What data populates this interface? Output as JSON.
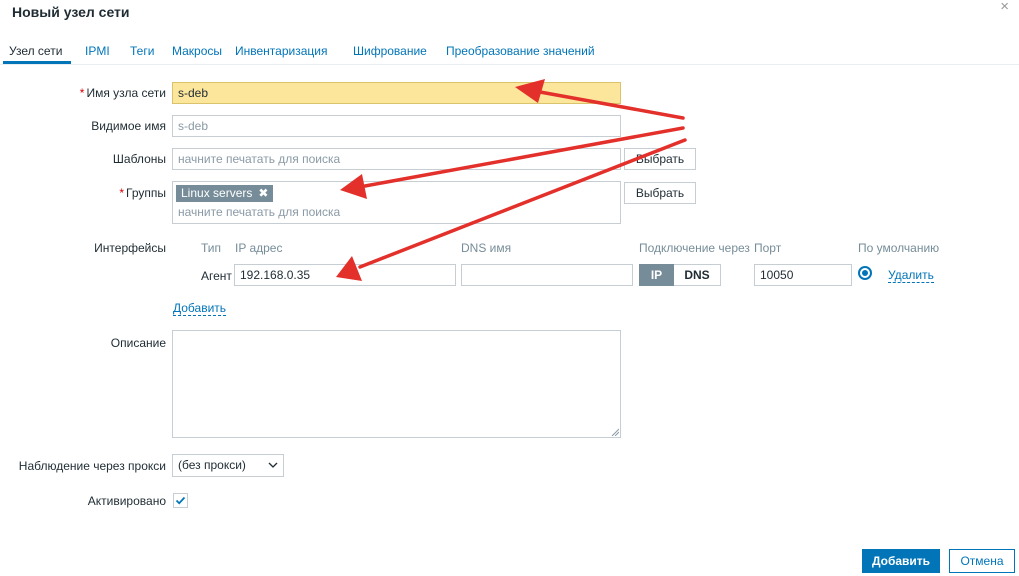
{
  "dialog": {
    "title": "Новый узел сети",
    "close_glyph": "×"
  },
  "tabs": [
    {
      "label": "Узел сети"
    },
    {
      "label": "IPMI"
    },
    {
      "label": "Теги"
    },
    {
      "label": "Макросы"
    },
    {
      "label": "Инвентаризация"
    },
    {
      "label": "Шифрование"
    },
    {
      "label": "Преобразование значений"
    }
  ],
  "required_mark": "*",
  "form": {
    "host_name": {
      "label": "Имя узла сети",
      "value": "s-deb"
    },
    "visible_name": {
      "label": "Видимое имя",
      "placeholder": "s-deb"
    },
    "templates": {
      "label": "Шаблоны",
      "placeholder": "начните печатать для поиска",
      "button": "Выбрать"
    },
    "groups": {
      "label": "Группы",
      "chip": "Linux servers",
      "chip_remove": "✖",
      "placeholder": "начните печатать для поиска",
      "button": "Выбрать"
    },
    "interfaces": {
      "label": "Интерфейсы",
      "headers": {
        "type": "Тип",
        "ip": "IP адрес",
        "dns": "DNS имя",
        "connect": "Подключение через",
        "port": "Порт",
        "default": "По умолчанию"
      },
      "row": {
        "type": "Агент",
        "ip": "192.168.0.35",
        "dns": "",
        "connect_ip": "IP",
        "connect_dns": "DNS",
        "port": "10050",
        "remove": "Удалить"
      },
      "add": "Добавить"
    },
    "description": {
      "label": "Описание",
      "value": ""
    },
    "proxy": {
      "label": "Наблюдение через прокси",
      "value": "(без прокси)"
    },
    "enabled": {
      "label": "Активировано",
      "checked": true
    }
  },
  "actions": {
    "add": "Добавить",
    "cancel": "Отмена"
  },
  "annotation_color": "#e3302b",
  "accent_color": "#0275b8"
}
